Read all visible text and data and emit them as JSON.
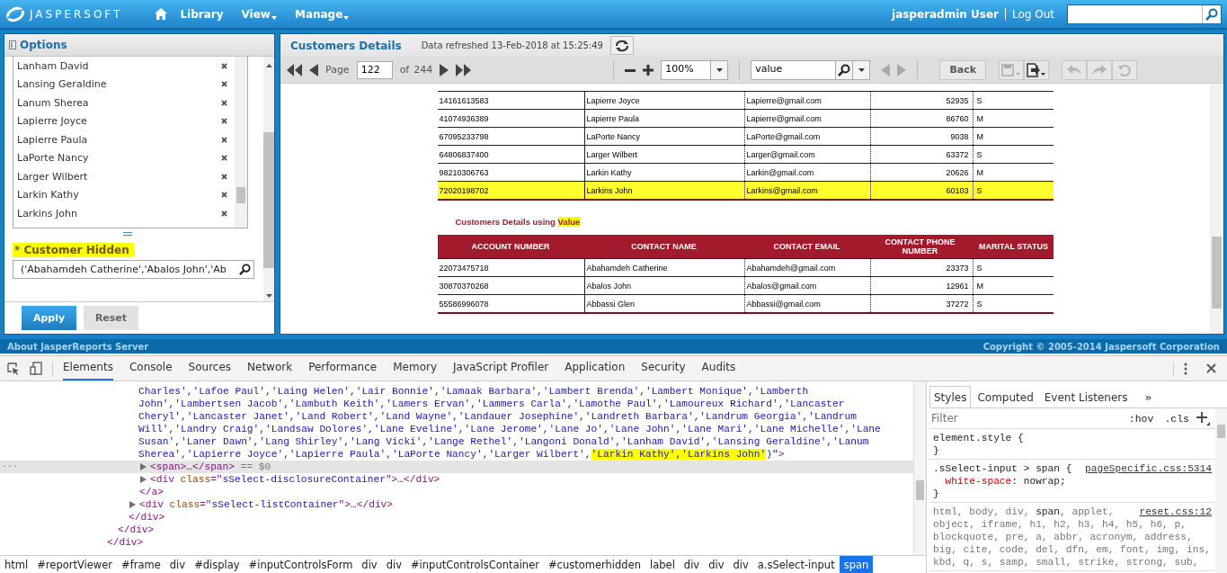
{
  "topbar": {
    "logo": "JASPERSOFT",
    "nav": [
      {
        "label": "Library",
        "dropdown": false
      },
      {
        "label": "View",
        "dropdown": true
      },
      {
        "label": "Manage",
        "dropdown": true
      }
    ],
    "user": "jasperadmin User",
    "logout": "Log Out"
  },
  "options": {
    "title": "Options",
    "selected_items": [
      "Lanham David",
      "Lansing Geraldine",
      "Lanum Sherea",
      "Lapierre Joyce",
      "Lapierre Paula",
      "LaPorte Nancy",
      "Larger Wilbert",
      "Larkin Kathy",
      "Larkins John"
    ],
    "required_mark": "*",
    "control_label": "Customer Hidden",
    "label_highlighted": true,
    "control_value": "('Abahamdeh Catherine','Abalos John','Ab",
    "buttons": [
      {
        "label": "Apply",
        "kind": "primary"
      },
      {
        "label": "Reset",
        "kind": "secondary"
      }
    ]
  },
  "report": {
    "title": "Customers Details",
    "refreshed": "Data refreshed 13-Feb-2018 at 15:25:49",
    "toolbar": {
      "page_label": "Page",
      "page": "122",
      "of_label": "of",
      "total_pages": "244",
      "zoom": "100%",
      "search": "value",
      "search_nav_disabled": true,
      "back": "Back",
      "save_disabled": true,
      "history_disabled": true
    },
    "table1_rows": [
      {
        "cells": [
          "14161613583",
          "Lapierre Joyce",
          "Lapierre@gmail.com",
          "52935",
          "S"
        ],
        "highlighted": false
      },
      {
        "cells": [
          "41074936389",
          "Lapierre Paula",
          "Lapierre@gmail.com",
          "86760",
          "M"
        ],
        "highlighted": false
      },
      {
        "cells": [
          "67095233798",
          "LaPorte Nancy",
          "LaPorte@gmail.com",
          "9038",
          "M"
        ],
        "highlighted": false
      },
      {
        "cells": [
          "64806837400",
          "Larger Wilbert",
          "Larger@gmail.com",
          "63372",
          "S"
        ],
        "highlighted": false
      },
      {
        "cells": [
          "98210306763",
          "Larkin Kathy",
          "Larkin@gmail.com",
          "20626",
          "M"
        ],
        "highlighted": false
      },
      {
        "cells": [
          "72020198702",
          "Larkins John",
          "Larkins@gmail.com",
          "60103",
          "S"
        ],
        "highlighted": true
      }
    ],
    "section2_title": "Customers Details using",
    "section2_highlighted_word": "Value",
    "table2_columns": [
      "ACCOUNT NUMBER",
      "CONTACT NAME",
      "CONTACT EMAIL",
      "CONTACT PHONE NUMBER",
      "MARITAL STATUS"
    ],
    "table2_rows": [
      {
        "cells": [
          "22073475718",
          "Abahamdeh Catherine",
          "Abahamdeh@gmail.com",
          "23373",
          "S"
        ],
        "highlighted": false
      },
      {
        "cells": [
          "30870370268",
          "Abalos John",
          "Abalos@gmail.com",
          "12961",
          "M"
        ],
        "highlighted": false
      },
      {
        "cells": [
          "55586996078",
          "Abbassi Glen",
          "Abbassi@gmail.com",
          "37272",
          "S"
        ],
        "highlighted": false
      }
    ]
  },
  "footer": {
    "about": "About JasperReports Server",
    "copyright": "Copyright © 2005-2014 Jaspersoft Corporation"
  },
  "devtools": {
    "tabs": [
      {
        "label": "Elements",
        "selected": true
      },
      {
        "label": "Console",
        "selected": false
      },
      {
        "label": "Sources",
        "selected": false
      },
      {
        "label": "Network",
        "selected": false
      },
      {
        "label": "Performance",
        "selected": false
      },
      {
        "label": "Memory",
        "selected": false
      },
      {
        "label": "JavaScript Profiler",
        "selected": false
      },
      {
        "label": "Application",
        "selected": false
      },
      {
        "label": "Security",
        "selected": false
      },
      {
        "label": "Audits",
        "selected": false
      }
    ],
    "dom": [
      {
        "close": "</div>",
        "children": [
          {
            "close": "</div>",
            "children": [
              {
                "close": "</div>",
                "children": [
                  {
                    "lines": [
                      [
                        {
                          "kind": "value",
                          "text": "Charles','Lafoe Paul','Laing Helen','Lair Bonnie','Lamaak Barbara','Lambert Brenda','Lambert Monique','Lamberth"
                        }
                      ],
                      [
                        {
                          "kind": "value",
                          "text": "John','Lambertsen Jacob','Lambuth Keith','Lamers Ervan','Lammers Carla','Lamothe Paul','Lamoureux Richard','Lancaster"
                        }
                      ],
                      [
                        {
                          "kind": "value",
                          "text": "Cheryl','Lancaster Janet','Land Robert','Land Wayne','Landauer Josephine','Landreth Barbara','Landrum Georgia','Landrum"
                        }
                      ],
                      [
                        {
                          "kind": "value",
                          "text": "Will','Landry Craig','Landsaw Dolores','Lane Eveline','Lane Jerome','Lane Jo','Lane John','Lane Mari','Lane Michelle','Lane"
                        }
                      ],
                      [
                        {
                          "kind": "value",
                          "text": "Susan','Laner Dawn','Lang Shirley','Lang Vicki','Lange Rethel','Langoni Donald','Lanham David','Lansing Geraldine','Lanum"
                        }
                      ],
                      [
                        {
                          "kind": "value",
                          "text": "Sherea','Lapierre Joyce','Lapierre Paula','LaPorte Nancy','Larger Wilbert',"
                        },
                        {
                          "kind": "highlight",
                          "text": "'Larkin Kathy','Larkins John'"
                        },
                        {
                          "kind": "value",
                          "text": ")\""
                        },
                        {
                          "kind": "tag",
                          "text": ">"
                        }
                      ]
                    ],
                    "close": "</a>",
                    "children": [
                      {
                        "lines": [
                          [
                            {
                              "kind": "tag",
                              "text": "<span>"
                            },
                            {
                              "kind": "text",
                              "text": "…"
                            },
                            {
                              "kind": "tag",
                              "text": "</span>"
                            },
                            {
                              "kind": "dim",
                              "text": " == $0"
                            }
                          ]
                        ],
                        "expanded": false,
                        "selected": true
                      },
                      {
                        "lines": [
                          [
                            {
                              "kind": "tag",
                              "text": "<div "
                            },
                            {
                              "kind": "attr",
                              "text": "class"
                            },
                            {
                              "kind": "tag",
                              "text": "=\""
                            },
                            {
                              "kind": "value",
                              "text": "sSelect-disclosureContainer"
                            },
                            {
                              "kind": "tag",
                              "text": "\">"
                            },
                            {
                              "kind": "text",
                              "text": "…"
                            },
                            {
                              "kind": "tag",
                              "text": "</div>"
                            }
                          ]
                        ],
                        "expanded": false,
                        "selected": false
                      }
                    ]
                  },
                  {
                    "lines": [
                      [
                        {
                          "kind": "tag",
                          "text": "<div "
                        },
                        {
                          "kind": "attr",
                          "text": "class"
                        },
                        {
                          "kind": "tag",
                          "text": "=\""
                        },
                        {
                          "kind": "value",
                          "text": "sSelect-listContainer"
                        },
                        {
                          "kind": "tag",
                          "text": "\">"
                        },
                        {
                          "kind": "text",
                          "text": "…"
                        },
                        {
                          "kind": "tag",
                          "text": "</div>"
                        }
                      ]
                    ],
                    "expanded": false,
                    "selected": false
                  }
                ]
              }
            ]
          }
        ]
      }
    ],
    "breadcrumbs": [
      {
        "label": "html",
        "selected": false
      },
      {
        "label": "#reportViewer",
        "selected": false
      },
      {
        "label": "#frame",
        "selected": false
      },
      {
        "label": "div",
        "selected": false
      },
      {
        "label": "#display",
        "selected": false
      },
      {
        "label": "#inputControlsForm",
        "selected": false
      },
      {
        "label": "div",
        "selected": false
      },
      {
        "label": "div",
        "selected": false
      },
      {
        "label": "#inputControlsContainer",
        "selected": false
      },
      {
        "label": "#customerhidden",
        "selected": false
      },
      {
        "label": "label",
        "selected": false
      },
      {
        "label": "div",
        "selected": false
      },
      {
        "label": "div",
        "selected": false
      },
      {
        "label": "div",
        "selected": false
      },
      {
        "label": "a.sSelect-input",
        "selected": false
      },
      {
        "label": "span",
        "selected": true
      }
    ],
    "side_tabs": [
      {
        "label": "Styles",
        "selected": true
      },
      {
        "label": "Computed",
        "selected": false
      },
      {
        "label": "Event Listeners",
        "selected": false
      }
    ],
    "selected_row_marker": "...",
    "more_tabs": "»",
    "filter_placeholder": "Filter",
    "hov": ":hov",
    "cls": ".cls",
    "rules": [
      {
        "lines": [
          [
            {
              "kind": "selector",
              "text": "element.style "
            },
            {
              "kind": "brace",
              "text": "{"
            }
          ],
          [
            {
              "kind": "brace",
              "text": "}"
            }
          ]
        ]
      },
      {
        "source": "pageSpecific.css:5314",
        "lines": [
          [
            {
              "kind": "selector",
              "text": ".sSelect-input > span "
            },
            {
              "kind": "brace",
              "text": "{"
            }
          ],
          [
            {
              "kind": "prop",
              "text": "  white-space"
            },
            {
              "kind": "brace",
              "text": ": nowrap;"
            }
          ],
          [
            {
              "kind": "brace",
              "text": "}"
            }
          ]
        ]
      },
      {
        "source": "reset.css:12",
        "lines": [
          [
            {
              "kind": "dim",
              "text": "html, body, div, "
            },
            {
              "kind": "selector",
              "text": "span"
            },
            {
              "kind": "dim",
              "text": ", applet,"
            }
          ],
          [
            {
              "kind": "dim",
              "text": "object, iframe, h1, h2, h3, h4, h5, h6, p,"
            }
          ],
          [
            {
              "kind": "dim",
              "text": "blockquote, pre, a, abbr, acronym, address,"
            }
          ],
          [
            {
              "kind": "dim",
              "text": "big, cite, code, del, dfn, em, font, img, ins,"
            }
          ],
          [
            {
              "kind": "dim",
              "text": "kbd, q, s, samp, small, strike, strong, sub,"
            }
          ]
        ]
      }
    ]
  }
}
